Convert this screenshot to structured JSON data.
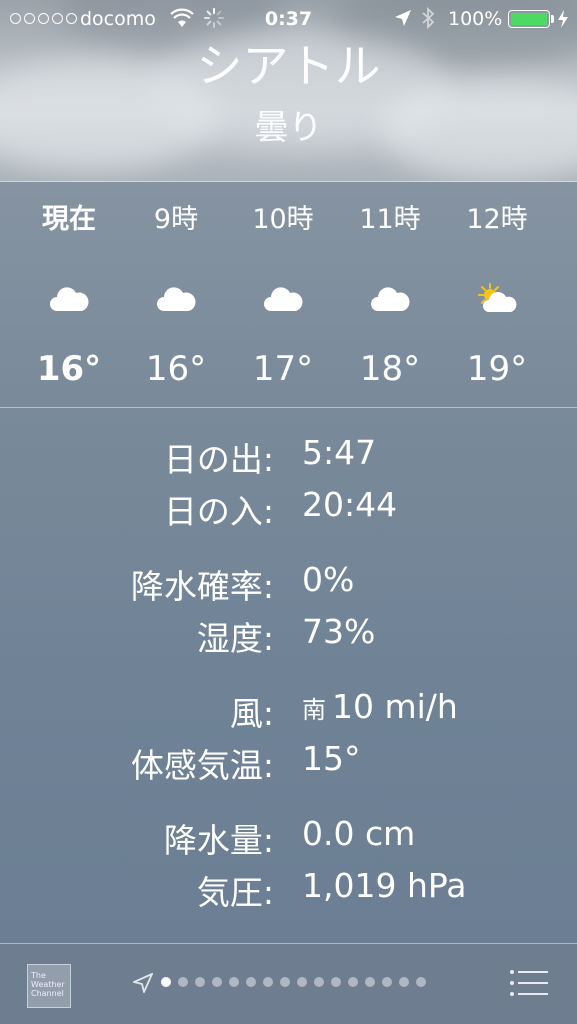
{
  "status_bar": {
    "carrier": "docomo",
    "time": "0:37",
    "battery": "100%",
    "signal_dots": 5
  },
  "header": {
    "city": "シアトル",
    "condition": "曇り"
  },
  "hourly": [
    {
      "label": "現在",
      "temp": "16°",
      "icon": "cloud-icon"
    },
    {
      "label": "9時",
      "temp": "16°",
      "icon": "cloud-icon"
    },
    {
      "label": "10時",
      "temp": "17°",
      "icon": "cloud-icon"
    },
    {
      "label": "11時",
      "temp": "18°",
      "icon": "cloud-icon"
    },
    {
      "label": "12時",
      "temp": "19°",
      "icon": "partly-sunny-icon"
    }
  ],
  "details": {
    "sunrise": {
      "label": "日の出:",
      "value": "5:47"
    },
    "sunset": {
      "label": "日の入:",
      "value": "20:44"
    },
    "precip_chance": {
      "label": "降水確率:",
      "value": "0%"
    },
    "humidity": {
      "label": "湿度:",
      "value": "73%"
    },
    "wind": {
      "label": "風:",
      "direction": "南",
      "value": "10 mi/h"
    },
    "feels_like": {
      "label": "体感気温:",
      "value": "15°"
    },
    "precipitation": {
      "label": "降水量:",
      "value": "0.0 cm"
    },
    "pressure": {
      "label": "気圧:",
      "value": "1,019 hPa"
    }
  },
  "bottom_bar": {
    "logo": "The Weather Channel",
    "page_count": 16,
    "active_page": 0
  },
  "colors": {
    "battery": "#4cd964",
    "sun": "#f5c518"
  }
}
